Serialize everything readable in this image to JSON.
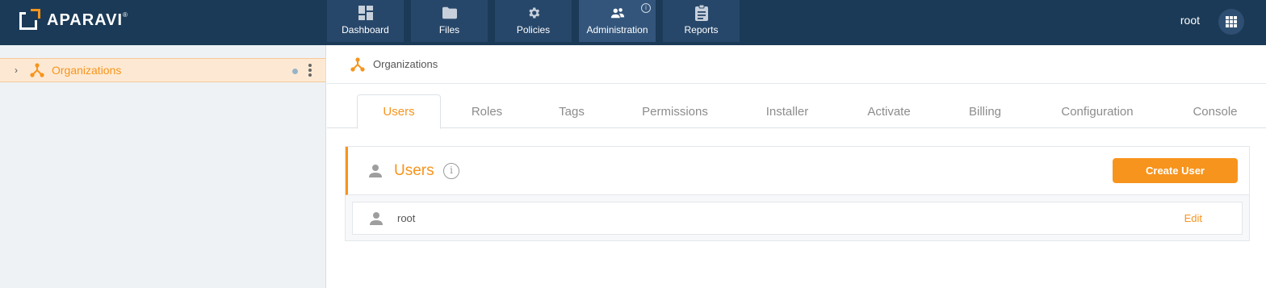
{
  "app": {
    "logo_text": "APARAVI",
    "logo_reg": "®"
  },
  "nav": {
    "items": [
      {
        "label": "Dashboard",
        "icon": "dashboard-icon"
      },
      {
        "label": "Files",
        "icon": "folder-icon"
      },
      {
        "label": "Policies",
        "icon": "gear-icon"
      },
      {
        "label": "Administration",
        "icon": "people-icon",
        "active": true,
        "badge": "i"
      },
      {
        "label": "Reports",
        "icon": "clipboard-icon"
      }
    ]
  },
  "header": {
    "username": "root"
  },
  "sidebar": {
    "tree": [
      {
        "label": "Organizations",
        "icon": "org-tree-icon",
        "selected": true
      }
    ]
  },
  "breadcrumb": {
    "label": "Organizations"
  },
  "tabs": [
    {
      "label": "Users",
      "active": true
    },
    {
      "label": "Roles"
    },
    {
      "label": "Tags"
    },
    {
      "label": "Permissions"
    },
    {
      "label": "Installer"
    },
    {
      "label": "Activate"
    },
    {
      "label": "Billing"
    },
    {
      "label": "Configuration"
    },
    {
      "label": "Console"
    }
  ],
  "panel": {
    "title": "Users",
    "info": "i",
    "create_button": "Create User",
    "rows": [
      {
        "name": "root",
        "action": "Edit"
      }
    ]
  },
  "colors": {
    "topbar": "#1b3a57",
    "accent": "#f7941d",
    "sidebar_bg": "#eef2f5"
  }
}
